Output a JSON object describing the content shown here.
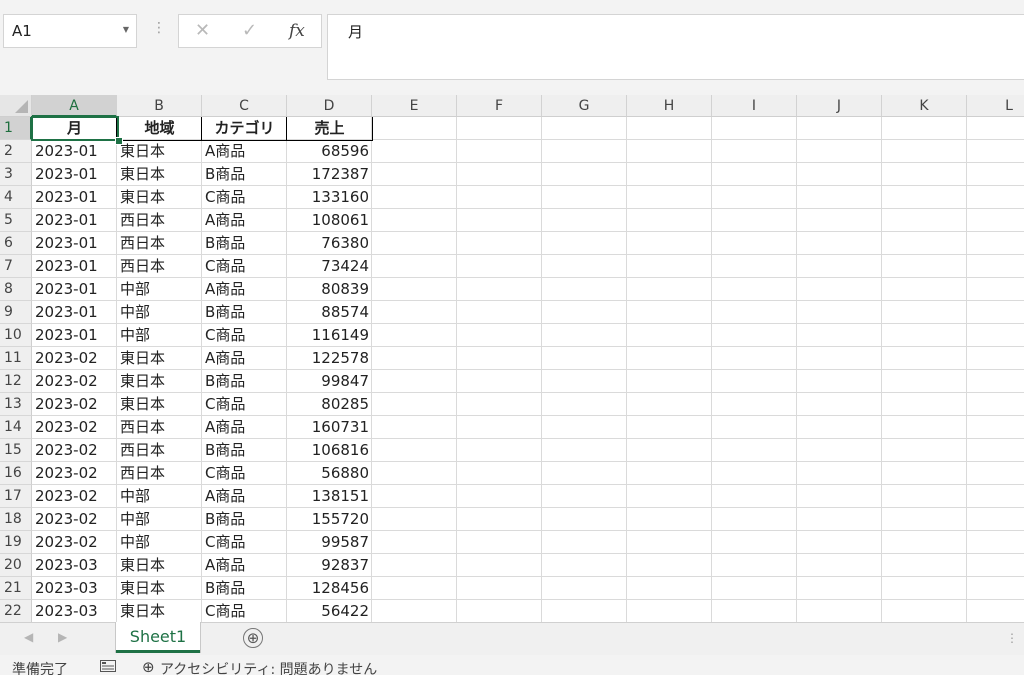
{
  "name_box": {
    "value": "A1"
  },
  "formula_bar": {
    "cancel_glyph": "✕",
    "enter_glyph": "✓",
    "fx_label": "fx",
    "content": "月"
  },
  "columns": [
    "A",
    "B",
    "C",
    "D",
    "E",
    "F",
    "G",
    "H",
    "I",
    "J",
    "K",
    "L"
  ],
  "row_numbers": [
    "1",
    "2",
    "3",
    "4",
    "5",
    "6",
    "7",
    "8",
    "9",
    "10",
    "11",
    "12",
    "13",
    "14",
    "15",
    "16",
    "17",
    "18",
    "19",
    "20",
    "21",
    "22"
  ],
  "table": {
    "headers": [
      "月",
      "地域",
      "カテゴリ",
      "売上"
    ],
    "rows": [
      [
        "2023-01",
        "東日本",
        "A商品",
        "68596"
      ],
      [
        "2023-01",
        "東日本",
        "B商品",
        "172387"
      ],
      [
        "2023-01",
        "東日本",
        "C商品",
        "133160"
      ],
      [
        "2023-01",
        "西日本",
        "A商品",
        "108061"
      ],
      [
        "2023-01",
        "西日本",
        "B商品",
        "76380"
      ],
      [
        "2023-01",
        "西日本",
        "C商品",
        "73424"
      ],
      [
        "2023-01",
        "中部",
        "A商品",
        "80839"
      ],
      [
        "2023-01",
        "中部",
        "B商品",
        "88574"
      ],
      [
        "2023-01",
        "中部",
        "C商品",
        "116149"
      ],
      [
        "2023-02",
        "東日本",
        "A商品",
        "122578"
      ],
      [
        "2023-02",
        "東日本",
        "B商品",
        "99847"
      ],
      [
        "2023-02",
        "東日本",
        "C商品",
        "80285"
      ],
      [
        "2023-02",
        "西日本",
        "A商品",
        "160731"
      ],
      [
        "2023-02",
        "西日本",
        "B商品",
        "106816"
      ],
      [
        "2023-02",
        "西日本",
        "C商品",
        "56880"
      ],
      [
        "2023-02",
        "中部",
        "A商品",
        "138151"
      ],
      [
        "2023-02",
        "中部",
        "B商品",
        "155720"
      ],
      [
        "2023-02",
        "中部",
        "C商品",
        "99587"
      ],
      [
        "2023-03",
        "東日本",
        "A商品",
        "92837"
      ],
      [
        "2023-03",
        "東日本",
        "B商品",
        "128456"
      ],
      [
        "2023-03",
        "東日本",
        "C商品",
        "56422"
      ]
    ]
  },
  "sheet_tabs": [
    {
      "label": "Sheet1",
      "active": true
    }
  ],
  "add_sheet_glyph": "⊕",
  "status_bar": {
    "ready": "準備完了",
    "accessibility": "アクセシビリティ: 問題ありません"
  },
  "colors": {
    "accent": "#1e7145",
    "header_bg": "#efefef",
    "grid_line": "#dadada"
  }
}
